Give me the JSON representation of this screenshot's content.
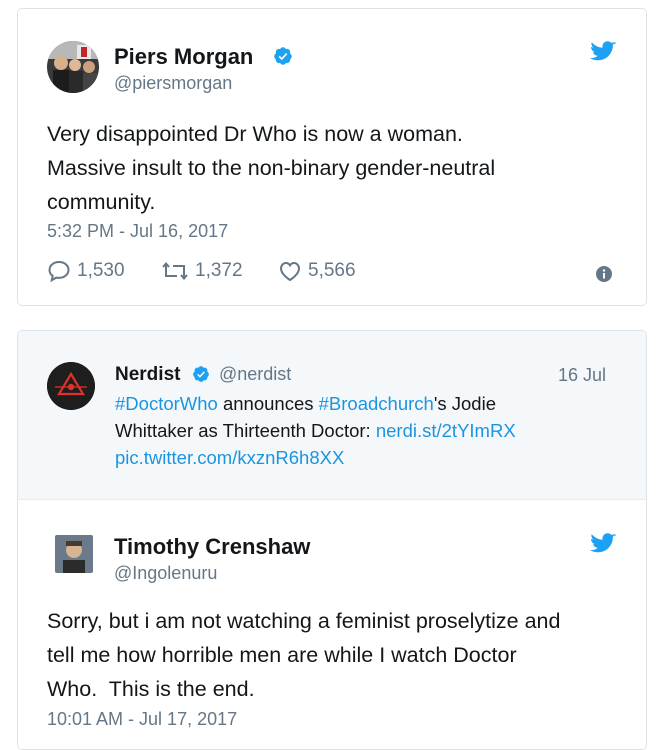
{
  "tweet1": {
    "author_name": "Piers Morgan",
    "author_handle": "@piersmorgan",
    "lines": [
      "Very disappointed Dr Who is now a woman.",
      "Massive insult to the non-binary gender-neutral",
      "community."
    ],
    "timestamp": "5:32 PM - Jul 16, 2017",
    "replies": "1,530",
    "retweets": "1,372",
    "likes": "5,566"
  },
  "quoted": {
    "author_name": "Nerdist",
    "author_handle": "@nerdist",
    "date": "16 Jul",
    "line1": {
      "hashtag1": "#DoctorWho",
      "text1": " announces ",
      "hashtag2": "#Broadchurch",
      "text2": "'s Jodie"
    },
    "line2": {
      "text": "Whittaker as Thirteenth Doctor: ",
      "link": "nerdi.st/2tYImRX"
    },
    "line3": {
      "link": "pic.twitter.com/kxznR6h8XX"
    }
  },
  "tweet2": {
    "author_name": "Timothy Crenshaw",
    "author_handle": "@Ingolenuru",
    "lines": [
      "Sorry, but i am not watching a feminist proselytize and",
      "tell me how horrible men are while I watch Doctor",
      "Who.  This is the end."
    ],
    "timestamp": "10:01 AM - Jul 17, 2017"
  },
  "colors": {
    "twitter_blue": "#1da1f2",
    "link_blue": "#1b95e0",
    "verified_blue": "#1da1f2",
    "muted_gray": "#657786"
  },
  "icons": [
    "twitter-bird-icon",
    "verified-badge-icon",
    "reply-icon",
    "retweet-icon",
    "like-icon",
    "info-icon"
  ]
}
